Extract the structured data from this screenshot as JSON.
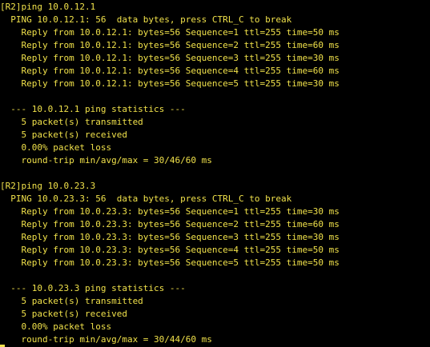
{
  "terminal": {
    "text_color": "#f0e14a",
    "background_color": "#000000",
    "lines": [
      "[R2]ping 10.0.12.1",
      "  PING 10.0.12.1: 56  data bytes, press CTRL_C to break",
      "    Reply from 10.0.12.1: bytes=56 Sequence=1 ttl=255 time=50 ms",
      "    Reply from 10.0.12.1: bytes=56 Sequence=2 ttl=255 time=60 ms",
      "    Reply from 10.0.12.1: bytes=56 Sequence=3 ttl=255 time=30 ms",
      "    Reply from 10.0.12.1: bytes=56 Sequence=4 ttl=255 time=60 ms",
      "    Reply from 10.0.12.1: bytes=56 Sequence=5 ttl=255 time=30 ms",
      "",
      "  --- 10.0.12.1 ping statistics ---",
      "    5 packet(s) transmitted",
      "    5 packet(s) received",
      "    0.00% packet loss",
      "    round-trip min/avg/max = 30/46/60 ms",
      "",
      "[R2]ping 10.0.23.3",
      "  PING 10.0.23.3: 56  data bytes, press CTRL_C to break",
      "    Reply from 10.0.23.3: bytes=56 Sequence=1 ttl=255 time=30 ms",
      "    Reply from 10.0.23.3: bytes=56 Sequence=2 ttl=255 time=60 ms",
      "    Reply from 10.0.23.3: bytes=56 Sequence=3 ttl=255 time=30 ms",
      "    Reply from 10.0.23.3: bytes=56 Sequence=4 ttl=255 time=50 ms",
      "    Reply from 10.0.23.3: bytes=56 Sequence=5 ttl=255 time=50 ms",
      "",
      "  --- 10.0.23.3 ping statistics ---",
      "    5 packet(s) transmitted",
      "    5 packet(s) received",
      "    0.00% packet loss",
      "    round-trip min/avg/max = 30/44/60 ms"
    ]
  }
}
